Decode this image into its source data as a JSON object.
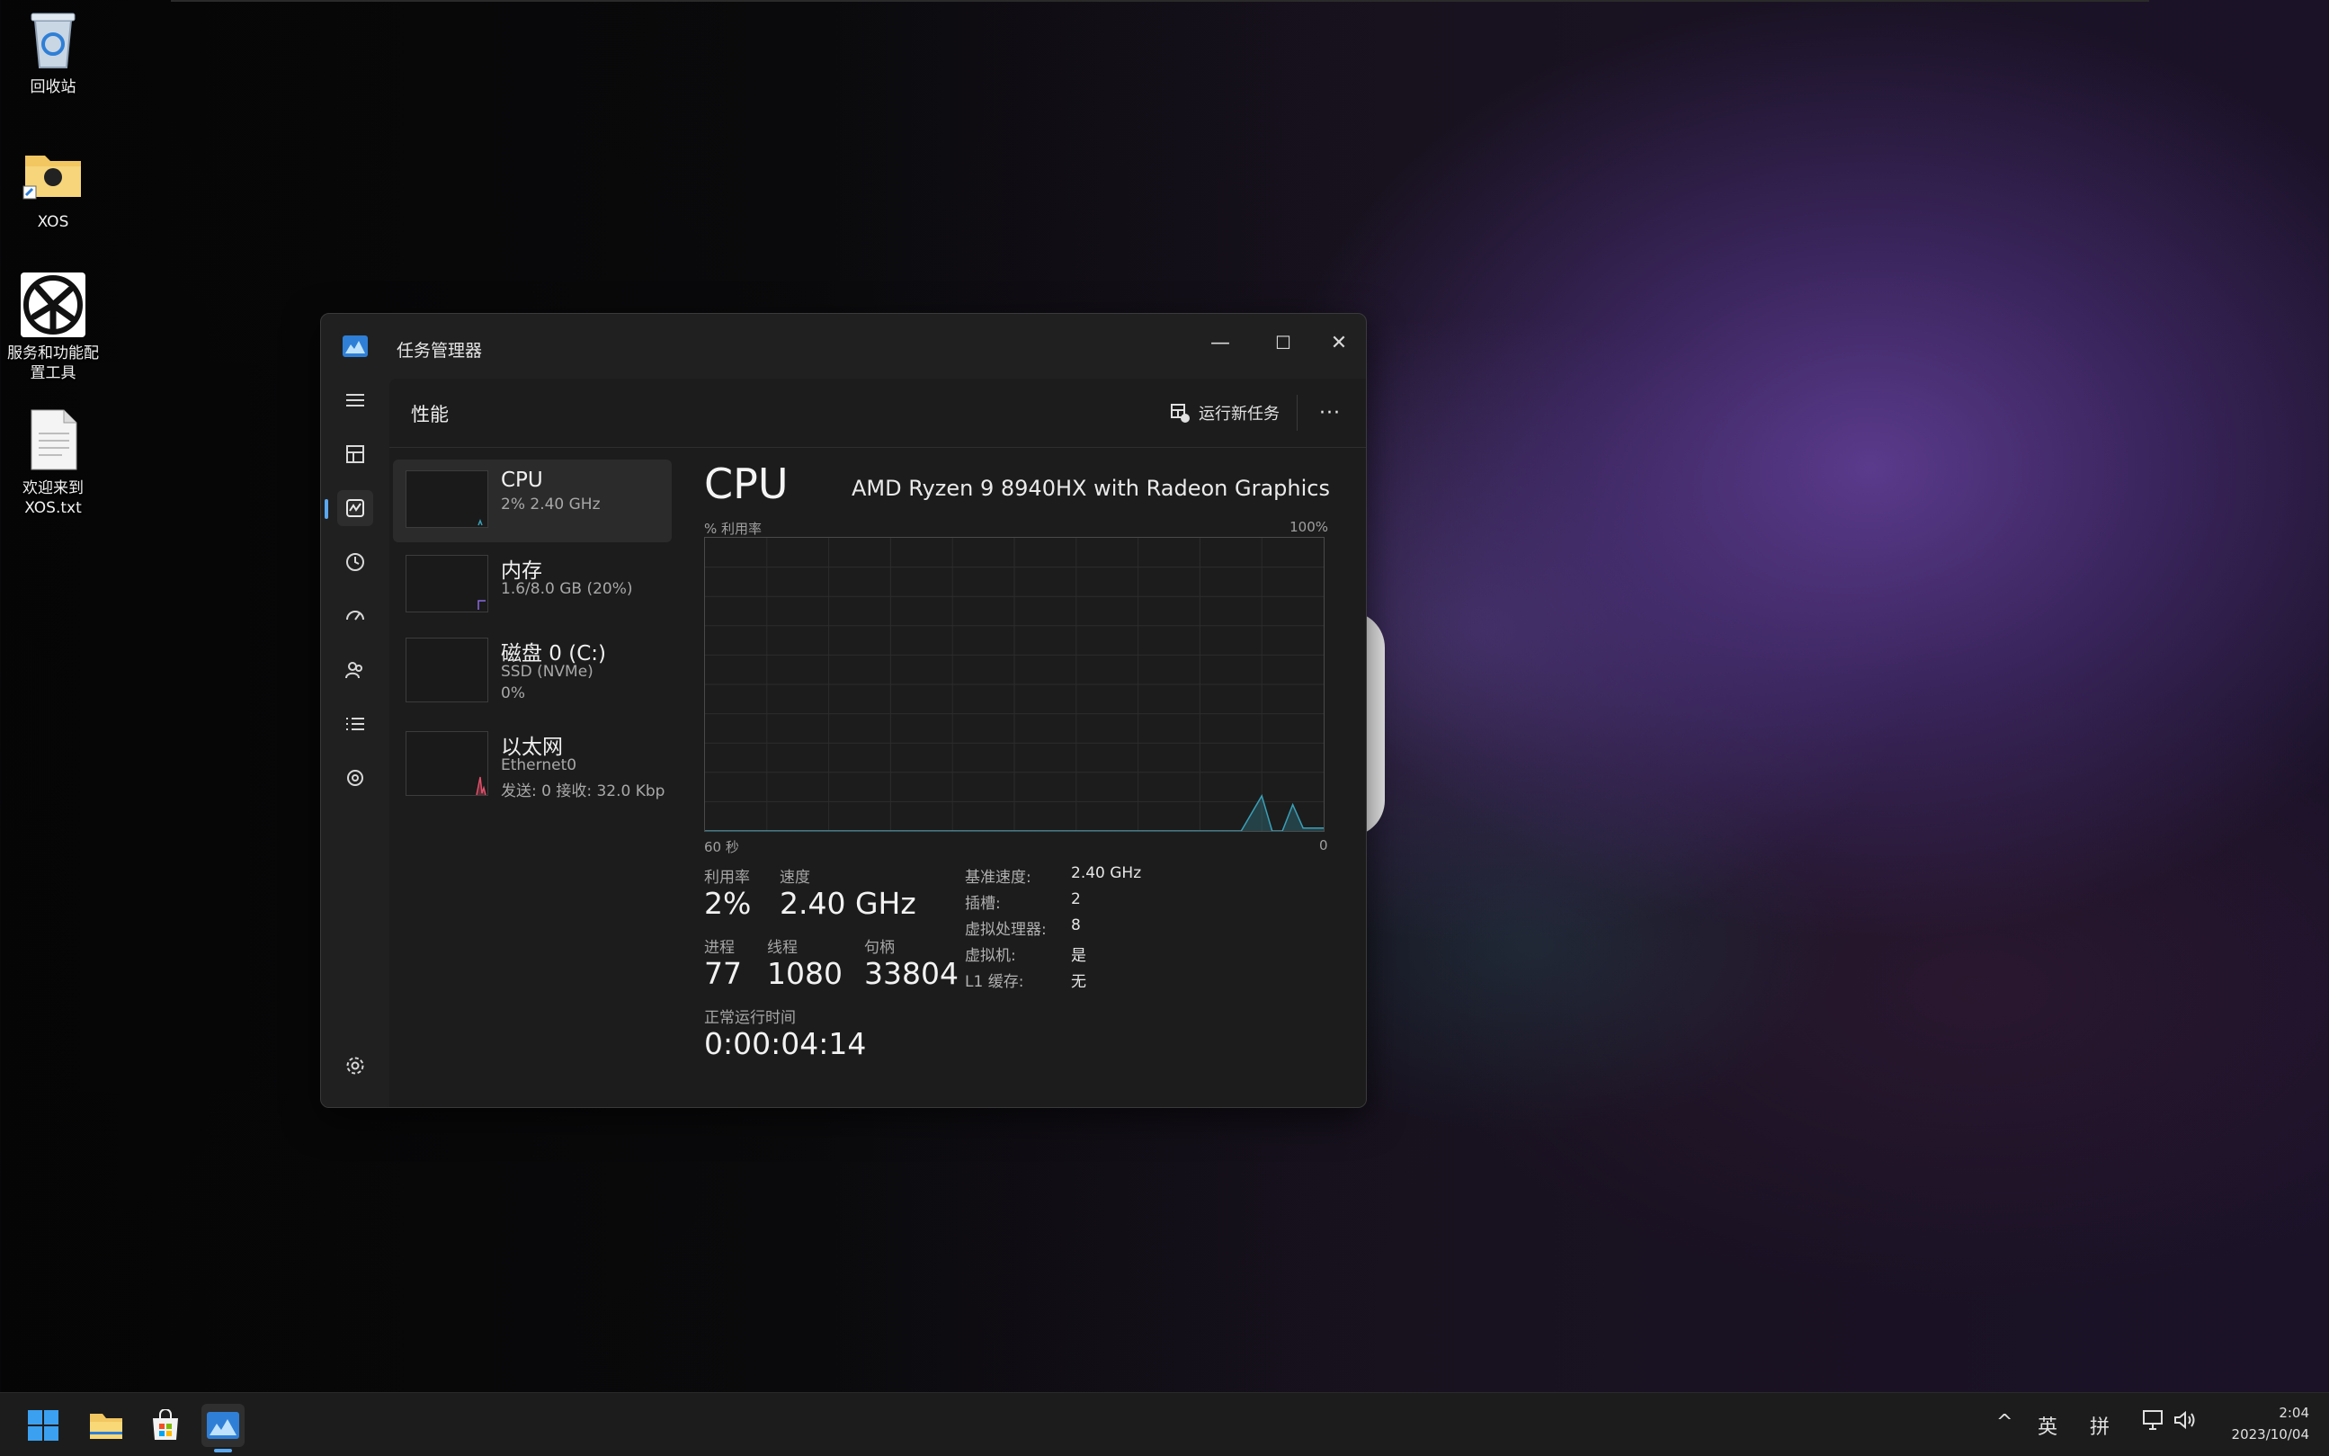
{
  "desktop": {
    "icons": [
      {
        "label": "回收站",
        "icon": "recycle-bin-icon"
      },
      {
        "label": "XOS",
        "icon": "folder-shortcut-icon"
      },
      {
        "label": "服务和功能配\n置工具",
        "icon": "service-tool-icon"
      },
      {
        "label": "欢迎来到\nXOS.txt",
        "icon": "text-file-icon"
      }
    ]
  },
  "window": {
    "title": "任务管理器",
    "controls": {
      "minimize": "—",
      "maximize": "☐",
      "close": "✕"
    },
    "page_title": "性能",
    "run_task": "运行新任务",
    "more": "···",
    "nav_icons": [
      "menu-icon",
      "processes-icon",
      "performance-icon",
      "app-history-icon",
      "startup-icon",
      "users-icon",
      "details-icon",
      "services-icon",
      "settings-icon"
    ]
  },
  "resources": [
    {
      "name": "CPU",
      "sub": [
        "2% 2.40 GHz"
      ]
    },
    {
      "name": "内存",
      "sub": [
        "1.6/8.0 GB (20%)"
      ]
    },
    {
      "name": "磁盘 0 (C:)",
      "sub": [
        "SSD (NVMe)",
        "0%"
      ]
    },
    {
      "name": "以太网",
      "sub": [
        "Ethernet0",
        "发送: 0 接收: 32.0 Kbp"
      ]
    }
  ],
  "detail": {
    "title": "CPU",
    "model": "AMD Ryzen 9 8940HX with Radeon Graphics",
    "y_label": "% 利用率",
    "y_max": "100%",
    "x_left": "60 秒",
    "x_right": "0",
    "stats": {
      "utilization_label": "利用率",
      "utilization": "2%",
      "speed_label": "速度",
      "speed": "2.40 GHz",
      "processes_label": "进程",
      "processes": "77",
      "threads_label": "线程",
      "threads": "1080",
      "handles_label": "句柄",
      "handles": "33804",
      "uptime_label": "正常运行时间",
      "uptime": "0:00:04:14"
    },
    "specs": [
      {
        "k": "基准速度:",
        "v": "2.40 GHz"
      },
      {
        "k": "插槽:",
        "v": "2"
      },
      {
        "k": "虚拟处理器:",
        "v": "8"
      },
      {
        "k": "虚拟机:",
        "v": "是"
      },
      {
        "k": "L1 缓存:",
        "v": "无"
      }
    ]
  },
  "chart_data": {
    "type": "area",
    "title": "",
    "xlabel": "60 秒",
    "ylabel": "% 利用率",
    "xlim": [
      60,
      0
    ],
    "ylim": [
      0,
      100
    ],
    "x": [
      60,
      8,
      6,
      5,
      4,
      3,
      2,
      1,
      0
    ],
    "values": [
      0,
      0,
      12,
      0,
      0,
      9,
      1,
      1,
      1
    ]
  },
  "taskbar": {
    "icons": [
      "start-icon",
      "file-explorer-icon",
      "store-icon",
      "task-manager-icon"
    ],
    "tray_chevron": "^",
    "tray_a": "英",
    "tray_b": "拼",
    "time": "2:04",
    "date": "2023/10/04"
  },
  "colors": {
    "accent": "#5aa8f0",
    "cpu_line": "#3aa0b8",
    "net_line": "#e0506a"
  }
}
